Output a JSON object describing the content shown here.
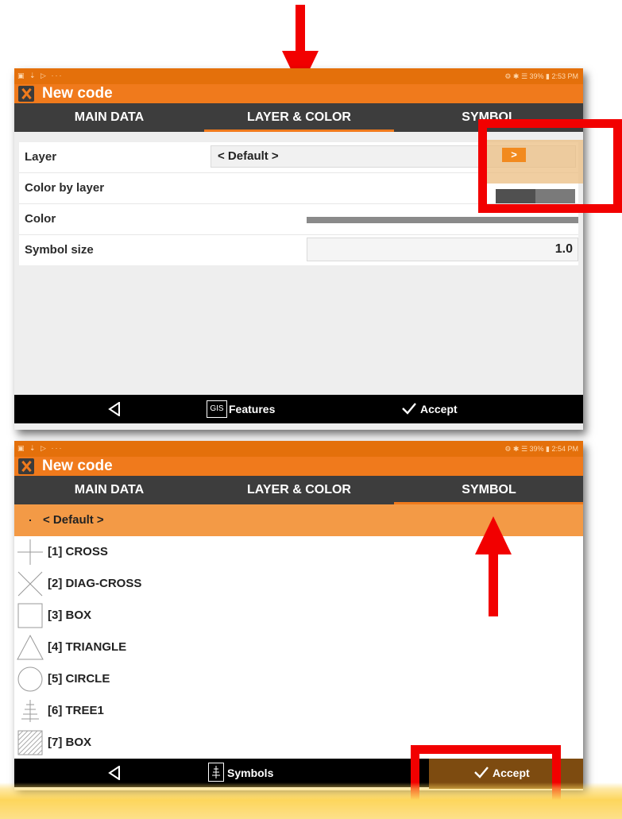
{
  "screen1": {
    "status_left": "▣ ⇣ ▷ ···",
    "status_right": "⚙ ✱ ☰ 39% ▮ 2:53 PM",
    "title": "New code",
    "tabs": [
      "MAIN DATA",
      "LAYER & COLOR",
      "SYMBOL"
    ],
    "active_tab": "LAYER & COLOR",
    "form": {
      "layer_label": "Layer",
      "layer_value": "< Default >",
      "color_by_layer_label": "Color by layer",
      "color_label": "Color",
      "color_value": "#8a8a8a",
      "symbol_size_label": "Symbol size",
      "symbol_size_value": "1.0",
      "arrow_glyph": ">"
    },
    "nav": {
      "features_icon_text": "GIS",
      "features_label": "Features",
      "accept_label": "Accept"
    }
  },
  "screen2": {
    "status_left": "▣ ⇣ ▷ ···",
    "status_right": "⚙ ✱ ☰ 39% ▮ 2:54 PM",
    "title": "New code",
    "tabs": [
      "MAIN DATA",
      "LAYER & COLOR",
      "SYMBOL"
    ],
    "active_tab": "SYMBOL",
    "selected_symbol": "< Default >",
    "symbols": [
      {
        "label": "[1] CROSS",
        "icon": "cross-icon"
      },
      {
        "label": "[2] DIAG-CROSS",
        "icon": "diag-cross-icon"
      },
      {
        "label": "[3] BOX",
        "icon": "box-icon"
      },
      {
        "label": "[4] TRIANGLE",
        "icon": "triangle-icon"
      },
      {
        "label": "[5] CIRCLE",
        "icon": "circle-icon"
      },
      {
        "label": "[6] TREE1",
        "icon": "tree-icon"
      },
      {
        "label": "[7] BOX",
        "icon": "hatched-box-icon"
      }
    ],
    "nav": {
      "symbols_label": "Symbols",
      "accept_label": "Accept"
    }
  },
  "colors": {
    "status_bar": "#e4700b",
    "title_bar": "#f07a1c",
    "tab_bar": "#3d3d3d",
    "selected_row": "#f39a46",
    "annotation": "#f20000",
    "highlight_band": "#fdd65c"
  }
}
